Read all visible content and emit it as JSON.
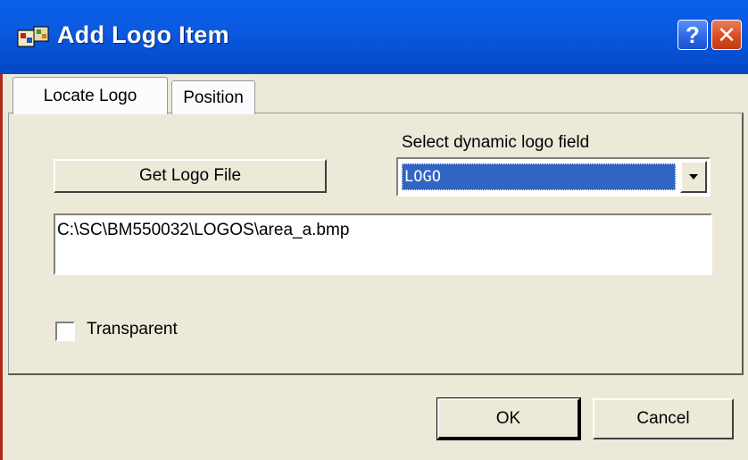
{
  "window": {
    "title": "Add Logo Item",
    "help_label": "?",
    "close_label": "✕"
  },
  "tabs": [
    {
      "label": "Locate Logo"
    },
    {
      "label": "Position"
    }
  ],
  "locate": {
    "get_logo_label": "Get Logo File",
    "dynamic_label": "Select dynamic logo field",
    "dynamic_value": "LOGO",
    "file_path": "C:\\SC\\BM550032\\LOGOS\\area_a.bmp",
    "transparent_label": "Transparent",
    "transparent_checked": false
  },
  "buttons": {
    "ok": "OK",
    "cancel": "Cancel"
  },
  "icons": {
    "app": "logo-app-icon",
    "help": "help-icon",
    "close": "close-icon",
    "dropdown": "chevron-down-icon"
  }
}
